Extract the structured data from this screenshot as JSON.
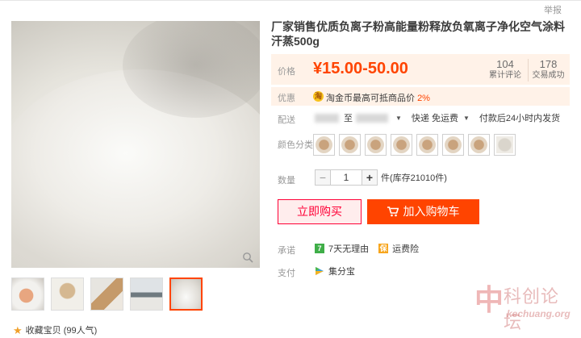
{
  "header": {
    "report": "举报"
  },
  "product": {
    "title": "厂家销售优质负离子粉高能量粉释放负氧离子净化空气涂料汗蒸500g"
  },
  "price": {
    "label": "价格",
    "range": "¥15.00-50.00",
    "reviews_count": "104",
    "reviews_label": "累计评论",
    "sales_count": "178",
    "sales_label": "交易成功"
  },
  "promo": {
    "label": "优惠",
    "text": "淘金币最高可抵商品价",
    "percent": "2%"
  },
  "shipping": {
    "label": "配送",
    "to": "至",
    "express": "快递 免运费",
    "dispatch": "付款后24小时内发货"
  },
  "color": {
    "label": "颜色分类",
    "swatch_count_note": ""
  },
  "quantity": {
    "label": "数量",
    "value": "1",
    "stock": "件(库存21010件)",
    "minus": "−",
    "plus": "+"
  },
  "actions": {
    "buy_now": "立即购买",
    "add_to_cart": "加入购物车"
  },
  "promise": {
    "label": "承诺",
    "return_badge": "7",
    "return_text": "7天无理由",
    "insurance_text": "运费险"
  },
  "payment": {
    "label": "支付",
    "method": "集分宝"
  },
  "favorite": {
    "text": "收藏宝贝 (99人气)"
  },
  "watermark": {
    "cn": "科创论坛",
    "en": "kechuang.org",
    "logo": "中"
  },
  "colors": {
    "accent": "#ff4400",
    "price_bg": "#fff2e8",
    "buy_border": "#ff0036"
  }
}
